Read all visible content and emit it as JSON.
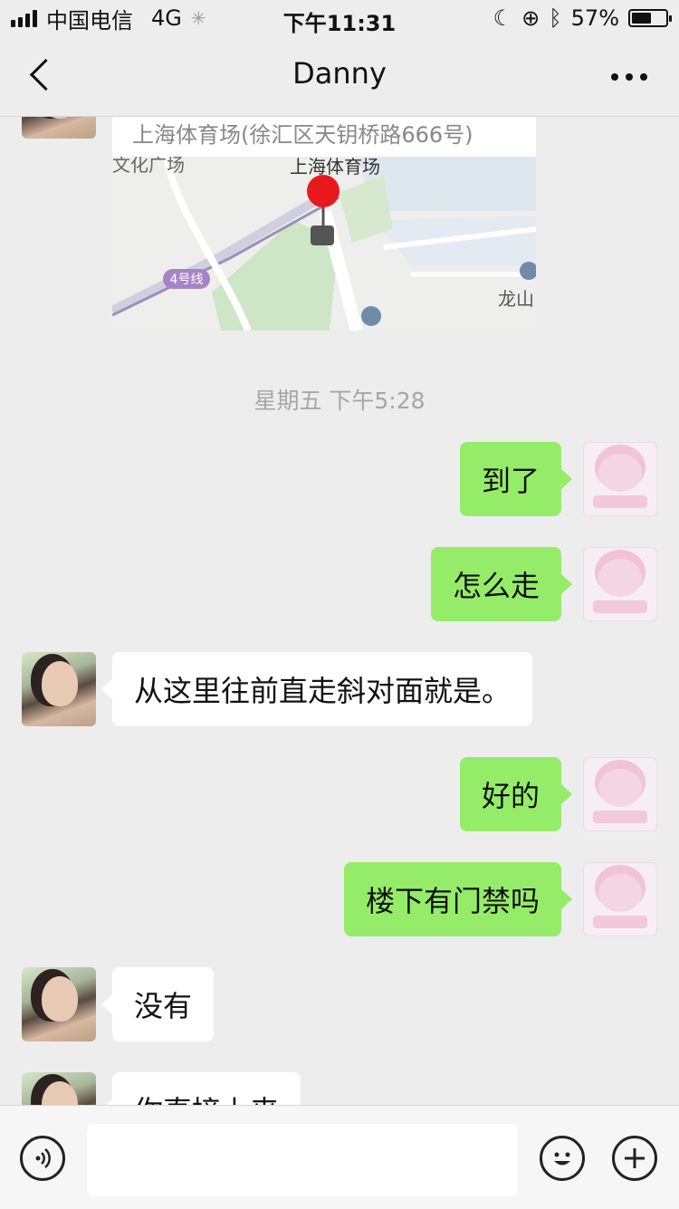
{
  "status_bar": {
    "carrier": "中国电信",
    "network": "4G",
    "time": "下午11:31",
    "battery_percent": "57%",
    "battery_level": 0.57
  },
  "nav": {
    "title": "Danny",
    "back_icon": "chevron-left-icon",
    "more_icon": "more-dots-icon"
  },
  "location_card": {
    "address": "上海体育场(徐汇区天钥桥路666号)",
    "map_labels": {
      "place": "上海体育场",
      "culture_square": "文化广场",
      "metro_line": "4号线",
      "longshan": "龙山"
    }
  },
  "timestamp": "星期五 下午5:28",
  "messages": [
    {
      "from": "me",
      "text": "到了"
    },
    {
      "from": "me",
      "text": "怎么走"
    },
    {
      "from": "her",
      "text": "从这里往前直走斜对面就是。"
    },
    {
      "from": "me",
      "text": "好的"
    },
    {
      "from": "me",
      "text": "楼下有门禁吗"
    },
    {
      "from": "her",
      "text": "没有"
    },
    {
      "from": "her",
      "text": "你直接上来"
    }
  ],
  "input_bar": {
    "voice_icon": "voice-icon",
    "input_value": "",
    "emoji_icon": "emoji-icon",
    "plus_icon": "plus-icon"
  },
  "colors": {
    "background": "#ededed",
    "my_bubble": "#95ec69",
    "their_bubble": "#ffffff",
    "timestamp": "#a6a6a6"
  }
}
